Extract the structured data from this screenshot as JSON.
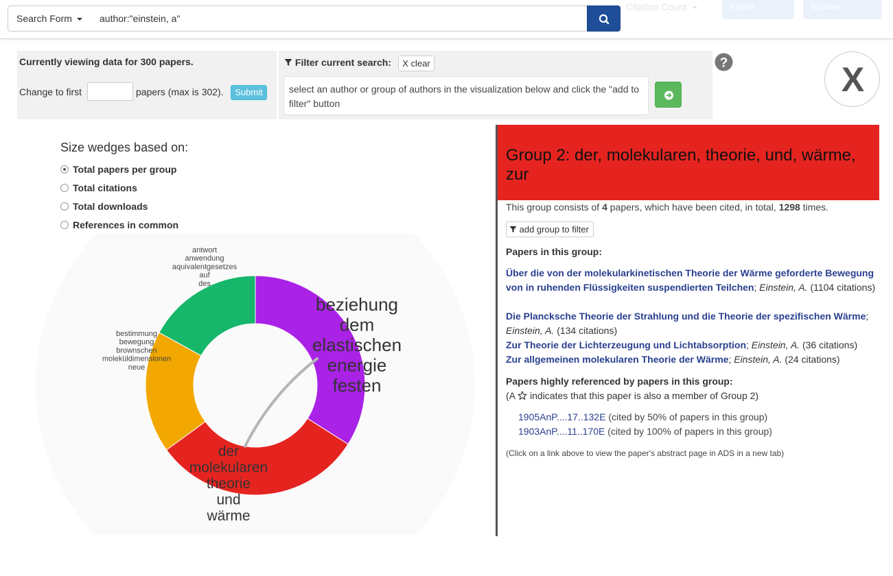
{
  "header": {
    "search_form_label": "Search Form",
    "search_query": "author:\"einstein, a\"",
    "ghost_sort_label": "Citation Count",
    "ghost_export_label": "Export",
    "ghost_explore_label": "Explore"
  },
  "viewing": {
    "title": "Currently viewing data for 300 papers.",
    "change_label": "Change to first",
    "count_value": "",
    "max_label": "papers (max is 302).",
    "submit_label": "Submit"
  },
  "filter": {
    "label": "Filter current search:",
    "clear_label": "X clear",
    "instructions": "select an author or group of authors in the visualization below and click the \"add to filter\" button"
  },
  "close_label": "X",
  "sizing": {
    "title": "Size wedges based on:",
    "options": [
      {
        "label": "Total papers per group",
        "checked": true
      },
      {
        "label": "Total citations",
        "checked": false
      },
      {
        "label": "Total downloads",
        "checked": false
      },
      {
        "label": "References in common",
        "checked": false
      }
    ]
  },
  "chart": {
    "groups": [
      {
        "color": "#a922e6",
        "value": 34,
        "words": [
          "beziehung",
          "dem",
          "elastischen",
          "energie",
          "festen"
        ]
      },
      {
        "color": "#e52420",
        "value": 31,
        "words": [
          "der",
          "molekularen",
          "theorie",
          "und",
          "wärme"
        ]
      },
      {
        "color": "#f2a800",
        "value": 18,
        "words": [
          "bestimmung",
          "bewegung",
          "brownschen",
          "moleküldimensionen",
          "neue"
        ]
      },
      {
        "color": "#16b76a",
        "value": 17,
        "words": [
          "antwort",
          "anwendung",
          "aquivalentgesetzes",
          "auf",
          "des"
        ]
      }
    ]
  },
  "group": {
    "title": "Group 2: der, molekularen, theorie, und, wärme, zur",
    "summary_prefix": "This group consists of",
    "paper_count": "4",
    "summary_middle": "papers, which have been cited, in total,",
    "citation_total": "1298",
    "summary_suffix": "times.",
    "add_label": "add group to filter",
    "papers_heading": "Papers in this group:",
    "papers": [
      {
        "title": "Über die von der molekularkinetischen Theorie der Wärme geforderte Bewegung von in ruhenden Flüssigkeiten suspendierten Teilchen",
        "author": "Einstein, A.",
        "citations": "(1104 citations)"
      },
      {
        "title": "Die Plancksche Theorie der Strahlung und die Theorie der spezifischen Wärme",
        "author": "Einstein, A.",
        "citations": "(134 citations)"
      },
      {
        "title": "Zur Theorie der Lichterzeugung und Lichtabsorption",
        "author": "Einstein, A.",
        "citations": "(36 citations)"
      },
      {
        "title": "Zur allgemeinen molekularen Theorie der Wärme",
        "author": "Einstein, A.",
        "citations": "(24 citations)"
      }
    ],
    "refs_heading": "Papers highly referenced by papers in this group:",
    "refs_note_prefix": "(A",
    "refs_note_suffix": "indicates that this paper is also a member of Group 2)",
    "refs": [
      {
        "bibcode": "1905AnP....17..132E",
        "note": "(cited by 50% of papers in this group)"
      },
      {
        "bibcode": "1903AnP....11..170E",
        "note": "(cited by 100% of papers in this group)"
      }
    ],
    "footnote": "(Click on a link above to view the paper's abstract page in ADS in a new tab)"
  },
  "colors": {
    "primary": "#1f4e99",
    "info": "#5bc0de",
    "success": "#5cb85c",
    "group_header": "#e52420",
    "link": "#2a3f8f"
  }
}
